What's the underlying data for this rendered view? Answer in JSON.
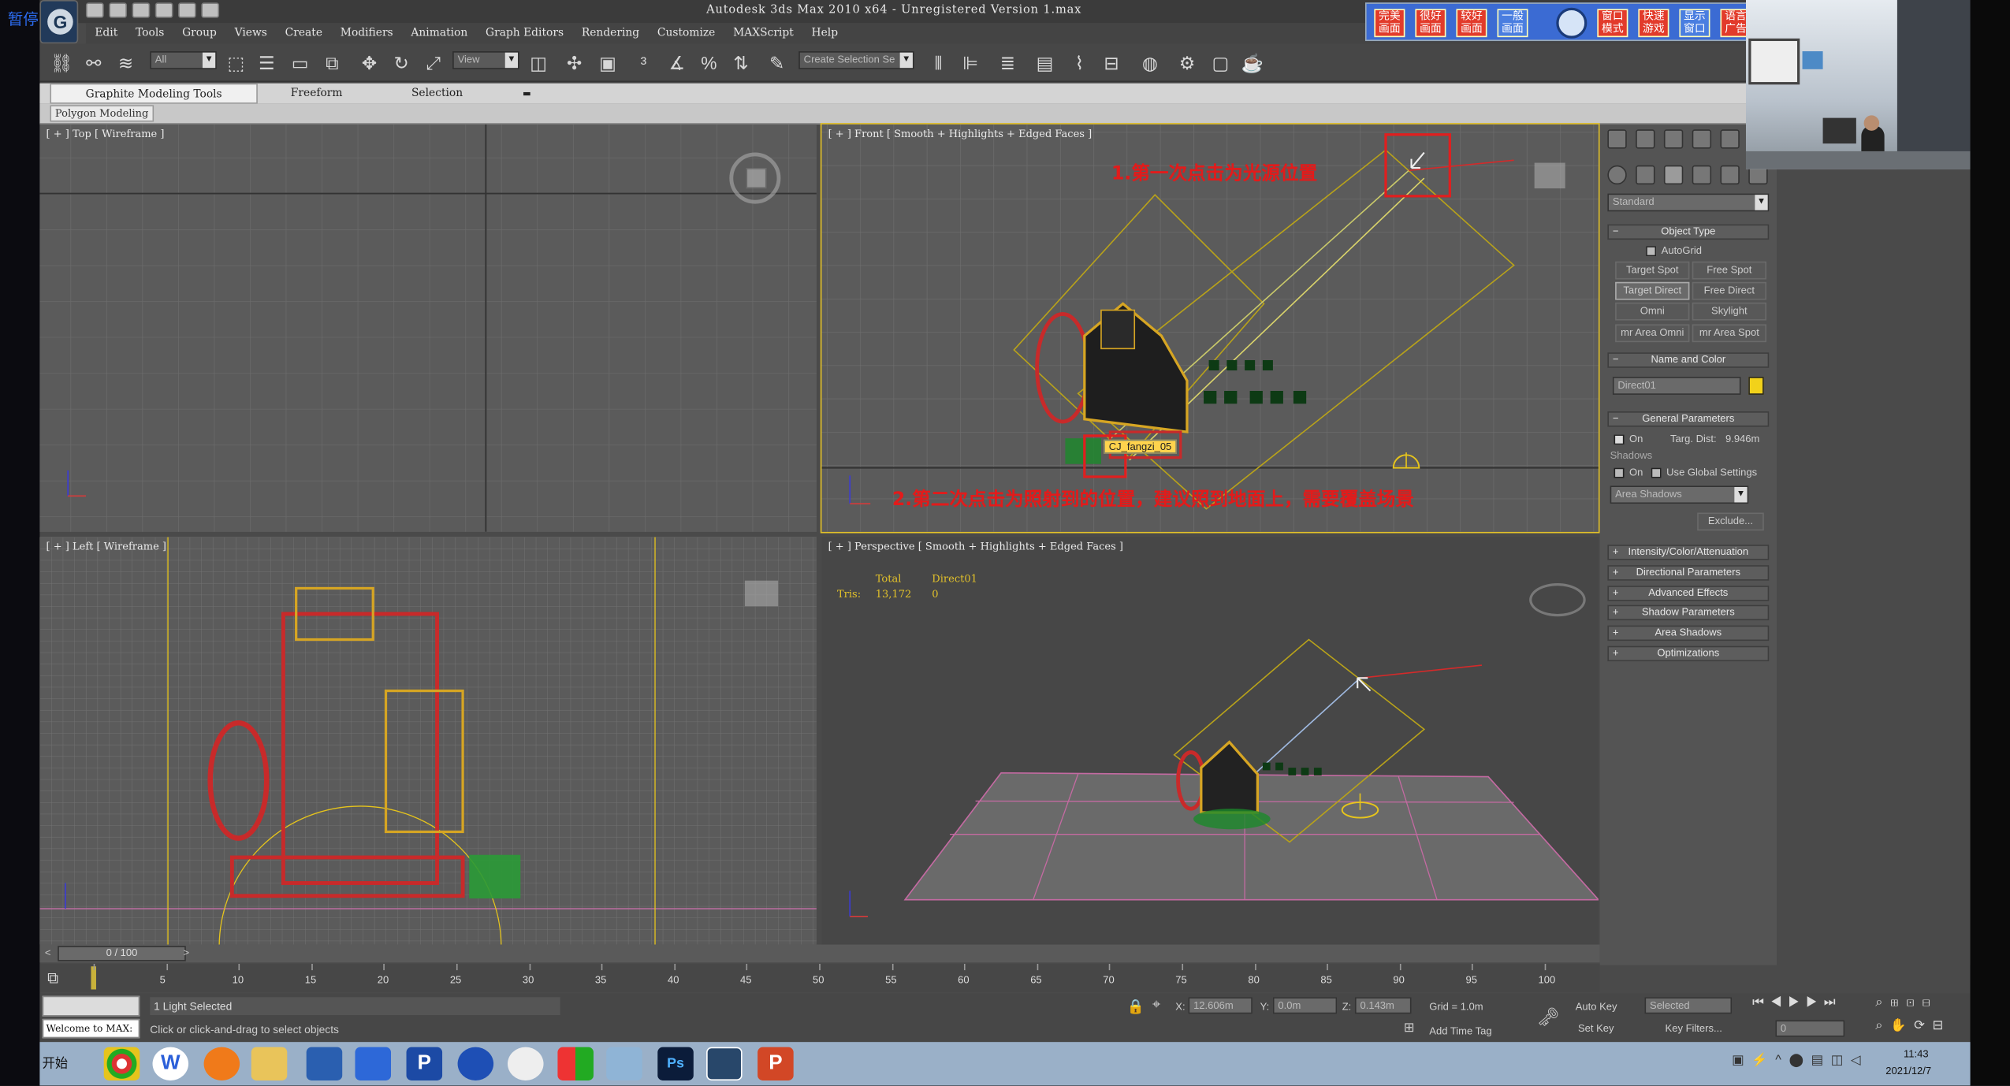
{
  "overlay": {
    "pause_label": "暂停"
  },
  "window": {
    "title": "Autodesk 3ds Max  2010 x64  - Unregistered Version  1.max"
  },
  "menu": [
    "Edit",
    "Tools",
    "Group",
    "Views",
    "Create",
    "Modifiers",
    "Animation",
    "Graph Editors",
    "Rendering",
    "Customize",
    "MAXScript",
    "Help"
  ],
  "ime_toolbar": {
    "buttons": [
      "完美\n画面",
      "很好\n画面",
      "较好\n画面",
      "一般\n画面",
      "窗口\n模式",
      "快速\n游戏",
      "显示\n窗口",
      "语言\n广告"
    ]
  },
  "toolbar": {
    "filter": "All",
    "ref_coord": "View",
    "selection_set": "Create Selection Se"
  },
  "ribbon": {
    "tabs": [
      "Graphite Modeling Tools",
      "Freeform",
      "Selection"
    ],
    "sub": "Polygon Modeling"
  },
  "viewports": {
    "top": "[ + ] Top [ Wireframe ]",
    "front": "[ + ] Front [ Smooth + Highlights + Edged Faces ]",
    "left": "[ + ] Left [ Wireframe ]",
    "perspective": "[ + ] Perspective [ Smooth + Highlights + Edged Faces ]"
  },
  "stats": {
    "total_label": "Total",
    "object_label": "Direct01",
    "tris_label": "Tris:",
    "tris_total": "13,172",
    "tris_object": "0"
  },
  "tooltip": "CJ_fangzi_05",
  "annotations": {
    "step1": "1.第一次点击为光源位置",
    "step2": "2.第二次点击为照射到的位置，建议照到地面上，需要覆盖场景"
  },
  "command_panel": {
    "category": "Standard",
    "object_type": "Object Type",
    "autogrid": "AutoGrid",
    "buttons": [
      "Target Spot",
      "Free Spot",
      "Target Direct",
      "Free Direct",
      "Omni",
      "Skylight",
      "mr Area Omni",
      "mr Area Spot"
    ],
    "name_and_color": "Name and Color",
    "name_value": "Direct01",
    "object_color": "#f2d21a",
    "general_parameters": "General Parameters",
    "on_label": "On",
    "targ_dist_label": "Targ. Dist:",
    "targ_dist_value": "9.946m",
    "shadows_label": "Shadows",
    "shadow_on_label": "On",
    "use_global": "Use Global Settings",
    "shadow_type": "Area Shadows",
    "exclude": "Exclude...",
    "rollouts": [
      "Intensity/Color/Attenuation",
      "Directional Parameters",
      "Advanced Effects",
      "Shadow Parameters",
      "Area Shadows",
      "Optimizations"
    ]
  },
  "timeline": {
    "frame": "0 / 100",
    "ticks": [
      "0",
      "5",
      "10",
      "15",
      "20",
      "25",
      "30",
      "35",
      "40",
      "45",
      "50",
      "55",
      "60",
      "65",
      "70",
      "75",
      "80",
      "85",
      "90",
      "95",
      "100"
    ]
  },
  "status": {
    "selected": "1 Light Selected",
    "prompt": "Click or click-and-drag to select objects",
    "welcome": "Welcome to MAX:",
    "x_label": "X:",
    "x_value": "12.606m",
    "y_label": "Y:",
    "y_value": "0.0m",
    "z_label": "Z:",
    "z_value": "0.143m",
    "grid": "Grid = 1.0m",
    "add_time_tag": "Add Time Tag",
    "auto_key": "Auto Key",
    "set_key": "Set Key",
    "key_mode": "Selected",
    "key_filters": "Key Filters...",
    "current_frame": "0"
  },
  "taskbar": {
    "start": "开始",
    "time": "11:43",
    "date": "2021/12/7"
  }
}
